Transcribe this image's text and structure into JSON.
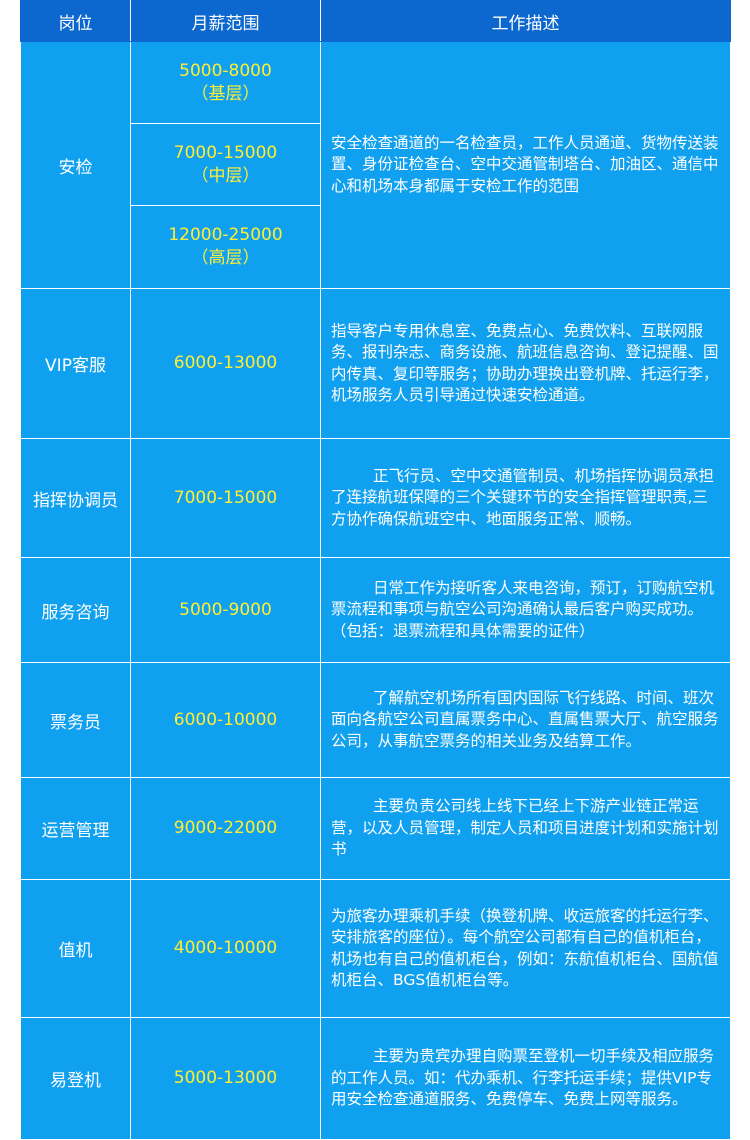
{
  "headers": {
    "position": "岗位",
    "salary": "月薪范围",
    "description": "工作描述"
  },
  "rows": [
    {
      "position": "安检",
      "salary_tiers": [
        {
          "range": "5000-8000",
          "level": "（基层）"
        },
        {
          "range": "7000-15000",
          "level": "（中层）"
        },
        {
          "range": "12000-25000",
          "level": "（高层）"
        }
      ],
      "description": "安全检查通道的一名检查员，工作人员通道、货物传送装置、身份证检查台、空中交通管制塔台、加油区、通信中心和机场本身都属于安检工作的范围"
    },
    {
      "position": "VIP客服",
      "salary": "6000-13000",
      "description": "指导客户专用休息室、免费点心、免费饮料、互联网服务、报刊杂志、商务设施、航班信息咨询、登记提醒、国内传真、复印等服务；协助办理换出登机牌、托运行李，机场服务人员引导通过快速安检通道。"
    },
    {
      "position": "指挥协调员",
      "salary": "7000-15000",
      "description": "正飞行员、空中交通管制员、机场指挥协调员承担了连接航班保障的三个关键环节的安全指挥管理职责,三方协作确保航班空中、地面服务正常、顺畅。"
    },
    {
      "position": "服务咨询",
      "salary": "5000-9000",
      "description": "日常工作为接听客人来电咨询，预订，订购航空机票流程和事项与航空公司沟通确认最后客户购买成功。（包括：退票流程和具体需要的证件）"
    },
    {
      "position": "票务员",
      "salary": "6000-10000",
      "description": "了解航空机场所有国内国际飞行线路、时间、班次面向各航空公司直属票务中心、直属售票大厅、航空服务公司，从事航空票务的相关业务及结算工作。"
    },
    {
      "position": "运营管理",
      "salary": "9000-22000",
      "description": "主要负责公司线上线下已经上下游产业链正常运营，以及人员管理，制定人员和项目进度计划和实施计划书"
    },
    {
      "position": "值机",
      "salary": "4000-10000",
      "description": "为旅客办理乘机手续（换登机牌、收运旅客的托运行李、安排旅客的座位）。每个航空公司都有自己的值机柜台，机场也有自己的值机柜台，例如：东航值机柜台、国航值机柜台、BGS值机柜台等。"
    },
    {
      "position": "易登机",
      "salary": "5000-13000",
      "description": "主要为贵宾办理自购票至登机一切手续及相应服务的工作人员。如：代办乘机、行李托运手续；提供VIP专用安全检查通道服务、免费停车、免费上网等服务。"
    }
  ]
}
